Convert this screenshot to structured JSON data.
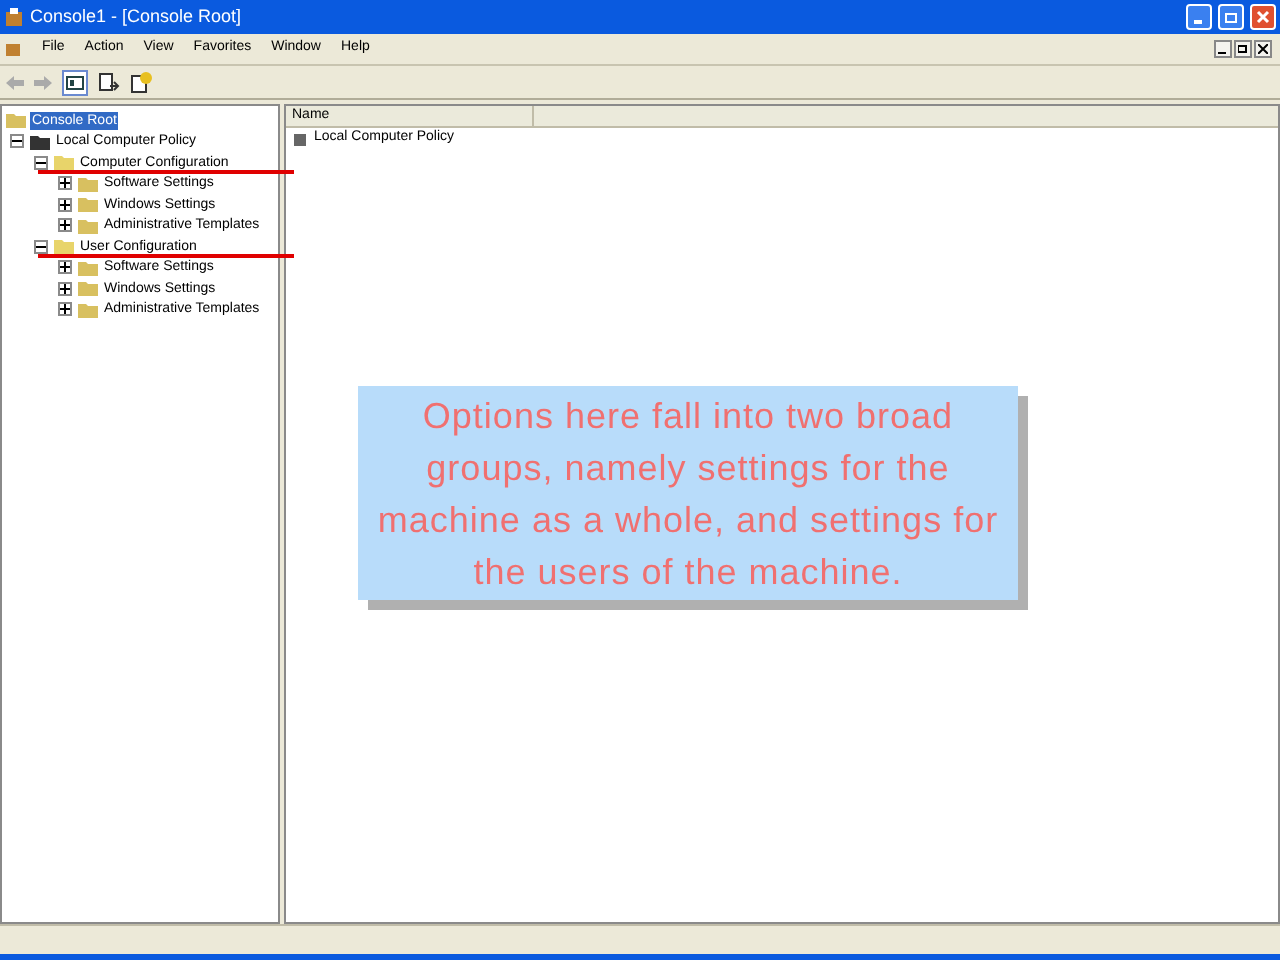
{
  "window": {
    "title": "Console1 - [Console Root]"
  },
  "menu": [
    "File",
    "Action",
    "View",
    "Favorites",
    "Window",
    "Help"
  ],
  "tree": [
    {
      "label": "Console Root",
      "selected": true,
      "underlined": false,
      "children": [
        {
          "label": "Local Computer Policy",
          "selected": false,
          "expanded": true,
          "underlined": false,
          "children": [
            {
              "label": "Computer Configuration",
              "selected": false,
              "expanded": true,
              "underlined": true,
              "children": [
                {
                  "label": "Software Settings",
                  "selected": false,
                  "expanded": false,
                  "underlined": false
                },
                {
                  "label": "Windows Settings",
                  "selected": false,
                  "expanded": false,
                  "underlined": false
                },
                {
                  "label": "Administrative Templates",
                  "selected": false,
                  "expanded": false,
                  "underlined": false
                }
              ]
            },
            {
              "label": "User Configuration",
              "selected": false,
              "expanded": true,
              "underlined": true,
              "children": [
                {
                  "label": "Software Settings",
                  "selected": false,
                  "expanded": false,
                  "underlined": false
                },
                {
                  "label": "Windows Settings",
                  "selected": false,
                  "expanded": false,
                  "underlined": false
                },
                {
                  "label": "Administrative Templates",
                  "selected": false,
                  "expanded": false,
                  "underlined": false
                }
              ]
            }
          ]
        }
      ]
    }
  ],
  "list": {
    "columns": [
      "Name"
    ],
    "rows": [
      "Local Computer Policy"
    ]
  },
  "callout": "Options here fall into two broad groups, namely settings for the machine as a whole, and settings for the users of the machine."
}
